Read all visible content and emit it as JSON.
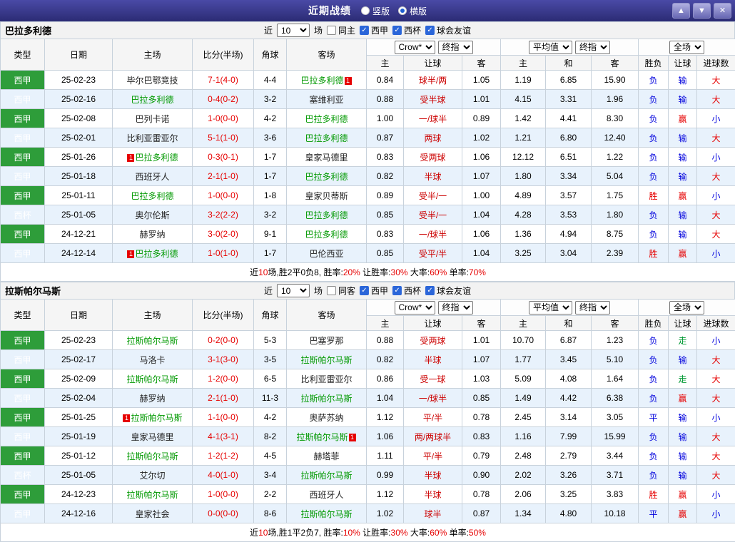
{
  "titlebar": {
    "title": "近期战绩",
    "radios": [
      {
        "label": "竖版",
        "selected": false
      },
      {
        "label": "横版",
        "selected": true
      }
    ],
    "buttons": [
      {
        "name": "up",
        "glyph": "▲"
      },
      {
        "name": "down",
        "glyph": "▼"
      },
      {
        "name": "close",
        "glyph": "✕"
      }
    ]
  },
  "icons": {
    "check": "✓",
    "red_card": "1"
  },
  "colors": {
    "titlebar": "#32327e",
    "league_green": "#2e9d3a",
    "cup_teal": "#0b7f6e",
    "focus_team": "#009900",
    "win_red": "#e60000",
    "lose_blue": "#0000dd",
    "push_green": "#009933",
    "zebra_blue": "#e8f2fc"
  },
  "table_header": {
    "main_columns": [
      "类型",
      "日期",
      "主场",
      "比分(半场)",
      "角球",
      "客场"
    ],
    "sub_columns": [
      "主",
      "让球",
      "客",
      "主",
      "和",
      "客",
      "胜负",
      "让球",
      "进球数"
    ]
  },
  "sections": [
    {
      "team": "巴拉多利德",
      "filters": {
        "prefix": "近",
        "games": "10",
        "suffix": "场",
        "checkboxes": [
          {
            "label": "同主",
            "checked": false
          },
          {
            "label": "西甲",
            "checked": true
          },
          {
            "label": "西杯",
            "checked": true
          },
          {
            "label": "球会友谊",
            "checked": true
          }
        ]
      },
      "odds_groups": [
        [
          "Crow*",
          "终指"
        ],
        [
          "平均值",
          "终指"
        ],
        [
          "全场"
        ]
      ],
      "rows": [
        {
          "league": "西甲",
          "cup": false,
          "date": "25-02-23",
          "home": {
            "name": "毕尔巴鄂竞技",
            "focus": false,
            "card": ""
          },
          "score": "7-1(4-0)",
          "corners": "4-4",
          "away": {
            "name": "巴拉多利德",
            "focus": true,
            "card": "after"
          },
          "odds": [
            "0.84",
            "球半/两",
            "1.05"
          ],
          "avg": [
            "1.19",
            "6.85",
            "15.90"
          ],
          "results": [
            [
              "负",
              "b"
            ],
            [
              "输",
              "b"
            ],
            [
              "大",
              "r"
            ]
          ]
        },
        {
          "league": "西甲",
          "cup": false,
          "date": "25-02-16",
          "home": {
            "name": "巴拉多利德",
            "focus": true,
            "card": ""
          },
          "score": "0-4(0-2)",
          "corners": "3-2",
          "away": {
            "name": "塞维利亚",
            "focus": false,
            "card": ""
          },
          "odds": [
            "0.88",
            "受半球",
            "1.01"
          ],
          "avg": [
            "4.15",
            "3.31",
            "1.96"
          ],
          "results": [
            [
              "负",
              "b"
            ],
            [
              "输",
              "b"
            ],
            [
              "大",
              "r"
            ]
          ]
        },
        {
          "league": "西甲",
          "cup": false,
          "date": "25-02-08",
          "home": {
            "name": "巴列卡诺",
            "focus": false,
            "card": ""
          },
          "score": "1-0(0-0)",
          "corners": "4-2",
          "away": {
            "name": "巴拉多利德",
            "focus": true,
            "card": ""
          },
          "odds": [
            "1.00",
            "一/球半",
            "0.89"
          ],
          "avg": [
            "1.42",
            "4.41",
            "8.30"
          ],
          "results": [
            [
              "负",
              "b"
            ],
            [
              "赢",
              "r"
            ],
            [
              "小",
              "b"
            ]
          ]
        },
        {
          "league": "西甲",
          "cup": false,
          "date": "25-02-01",
          "home": {
            "name": "比利亚雷亚尔",
            "focus": false,
            "card": ""
          },
          "score": "5-1(1-0)",
          "corners": "3-6",
          "away": {
            "name": "巴拉多利德",
            "focus": true,
            "card": ""
          },
          "odds": [
            "0.87",
            "两球",
            "1.02"
          ],
          "avg": [
            "1.21",
            "6.80",
            "12.40"
          ],
          "results": [
            [
              "负",
              "b"
            ],
            [
              "输",
              "b"
            ],
            [
              "大",
              "r"
            ]
          ]
        },
        {
          "league": "西甲",
          "cup": false,
          "date": "25-01-26",
          "home": {
            "name": "巴拉多利德",
            "focus": true,
            "card": "before"
          },
          "score": "0-3(0-1)",
          "corners": "1-7",
          "away": {
            "name": "皇家马德里",
            "focus": false,
            "card": ""
          },
          "odds": [
            "0.83",
            "受两球",
            "1.06"
          ],
          "avg": [
            "12.12",
            "6.51",
            "1.22"
          ],
          "results": [
            [
              "负",
              "b"
            ],
            [
              "输",
              "b"
            ],
            [
              "小",
              "b"
            ]
          ]
        },
        {
          "league": "西甲",
          "cup": false,
          "date": "25-01-18",
          "home": {
            "name": "西班牙人",
            "focus": false,
            "card": ""
          },
          "score": "2-1(1-0)",
          "corners": "1-7",
          "away": {
            "name": "巴拉多利德",
            "focus": true,
            "card": ""
          },
          "odds": [
            "0.82",
            "半球",
            "1.07"
          ],
          "avg": [
            "1.80",
            "3.34",
            "5.04"
          ],
          "results": [
            [
              "负",
              "b"
            ],
            [
              "输",
              "b"
            ],
            [
              "大",
              "r"
            ]
          ]
        },
        {
          "league": "西甲",
          "cup": false,
          "date": "25-01-11",
          "home": {
            "name": "巴拉多利德",
            "focus": true,
            "card": ""
          },
          "score": "1-0(0-0)",
          "corners": "1-8",
          "away": {
            "name": "皇家贝蒂斯",
            "focus": false,
            "card": ""
          },
          "odds": [
            "0.89",
            "受半/一",
            "1.00"
          ],
          "avg": [
            "4.89",
            "3.57",
            "1.75"
          ],
          "results": [
            [
              "胜",
              "r"
            ],
            [
              "赢",
              "r"
            ],
            [
              "小",
              "b"
            ]
          ]
        },
        {
          "league": "西杯",
          "cup": true,
          "date": "25-01-05",
          "home": {
            "name": "奥尔伦斯",
            "focus": false,
            "card": ""
          },
          "score": "3-2(2-2)",
          "corners": "3-2",
          "away": {
            "name": "巴拉多利德",
            "focus": true,
            "card": ""
          },
          "odds": [
            "0.85",
            "受半/一",
            "1.04"
          ],
          "avg": [
            "4.28",
            "3.53",
            "1.80"
          ],
          "results": [
            [
              "负",
              "b"
            ],
            [
              "输",
              "b"
            ],
            [
              "大",
              "r"
            ]
          ]
        },
        {
          "league": "西甲",
          "cup": false,
          "date": "24-12-21",
          "home": {
            "name": "赫罗纳",
            "focus": false,
            "card": ""
          },
          "score": "3-0(2-0)",
          "corners": "9-1",
          "away": {
            "name": "巴拉多利德",
            "focus": true,
            "card": ""
          },
          "odds": [
            "0.83",
            "一/球半",
            "1.06"
          ],
          "avg": [
            "1.36",
            "4.94",
            "8.75"
          ],
          "results": [
            [
              "负",
              "b"
            ],
            [
              "输",
              "b"
            ],
            [
              "大",
              "r"
            ]
          ]
        },
        {
          "league": "西甲",
          "cup": false,
          "date": "24-12-14",
          "home": {
            "name": "巴拉多利德",
            "focus": true,
            "card": "before"
          },
          "score": "1-0(1-0)",
          "corners": "1-7",
          "away": {
            "name": "巴伦西亚",
            "focus": false,
            "card": ""
          },
          "odds": [
            "0.85",
            "受平/半",
            "1.04"
          ],
          "avg": [
            "3.25",
            "3.04",
            "2.39"
          ],
          "results": [
            [
              "胜",
              "r"
            ],
            [
              "赢",
              "r"
            ],
            [
              "小",
              "b"
            ]
          ]
        }
      ],
      "summary": [
        [
          "近",
          "k"
        ],
        [
          "10",
          "r"
        ],
        [
          "场,胜2平0负8, 胜率:",
          "k"
        ],
        [
          "20%",
          "r"
        ],
        [
          " 让胜率:",
          "k"
        ],
        [
          "30%",
          "r"
        ],
        [
          " 大率:",
          "k"
        ],
        [
          "60%",
          "r"
        ],
        [
          " 单率:",
          "k"
        ],
        [
          "70%",
          "r"
        ]
      ]
    },
    {
      "team": "拉斯帕尔马斯",
      "filters": {
        "prefix": "近",
        "games": "10",
        "suffix": "场",
        "checkboxes": [
          {
            "label": "同客",
            "checked": false
          },
          {
            "label": "西甲",
            "checked": true
          },
          {
            "label": "西杯",
            "checked": true
          },
          {
            "label": "球会友谊",
            "checked": true
          }
        ]
      },
      "odds_groups": [
        [
          "Crow*",
          "终指"
        ],
        [
          "平均值",
          "终指"
        ],
        [
          "全场"
        ]
      ],
      "rows": [
        {
          "league": "西甲",
          "cup": false,
          "date": "25-02-23",
          "home": {
            "name": "拉斯帕尔马斯",
            "focus": true,
            "card": ""
          },
          "score": "0-2(0-0)",
          "corners": "5-3",
          "away": {
            "name": "巴塞罗那",
            "focus": false,
            "card": ""
          },
          "odds": [
            "0.88",
            "受两球",
            "1.01"
          ],
          "avg": [
            "10.70",
            "6.87",
            "1.23"
          ],
          "results": [
            [
              "负",
              "b"
            ],
            [
              "走",
              "g"
            ],
            [
              "小",
              "b"
            ]
          ]
        },
        {
          "league": "西甲",
          "cup": false,
          "date": "25-02-17",
          "home": {
            "name": "马洛卡",
            "focus": false,
            "card": ""
          },
          "score": "3-1(3-0)",
          "corners": "3-5",
          "away": {
            "name": "拉斯帕尔马斯",
            "focus": true,
            "card": ""
          },
          "odds": [
            "0.82",
            "半球",
            "1.07"
          ],
          "avg": [
            "1.77",
            "3.45",
            "5.10"
          ],
          "results": [
            [
              "负",
              "b"
            ],
            [
              "输",
              "b"
            ],
            [
              "大",
              "r"
            ]
          ]
        },
        {
          "league": "西甲",
          "cup": false,
          "date": "25-02-09",
          "home": {
            "name": "拉斯帕尔马斯",
            "focus": true,
            "card": ""
          },
          "score": "1-2(0-0)",
          "corners": "6-5",
          "away": {
            "name": "比利亚雷亚尔",
            "focus": false,
            "card": ""
          },
          "odds": [
            "0.86",
            "受一球",
            "1.03"
          ],
          "avg": [
            "5.09",
            "4.08",
            "1.64"
          ],
          "results": [
            [
              "负",
              "b"
            ],
            [
              "走",
              "g"
            ],
            [
              "大",
              "r"
            ]
          ]
        },
        {
          "league": "西甲",
          "cup": false,
          "date": "25-02-04",
          "home": {
            "name": "赫罗纳",
            "focus": false,
            "card": ""
          },
          "score": "2-1(1-0)",
          "corners": "11-3",
          "away": {
            "name": "拉斯帕尔马斯",
            "focus": true,
            "card": ""
          },
          "odds": [
            "1.04",
            "一/球半",
            "0.85"
          ],
          "avg": [
            "1.49",
            "4.42",
            "6.38"
          ],
          "results": [
            [
              "负",
              "b"
            ],
            [
              "赢",
              "r"
            ],
            [
              "大",
              "r"
            ]
          ]
        },
        {
          "league": "西甲",
          "cup": false,
          "date": "25-01-25",
          "home": {
            "name": "拉斯帕尔马斯",
            "focus": true,
            "card": "before"
          },
          "score": "1-1(0-0)",
          "corners": "4-2",
          "away": {
            "name": "奥萨苏纳",
            "focus": false,
            "card": ""
          },
          "odds": [
            "1.12",
            "平/半",
            "0.78"
          ],
          "avg": [
            "2.45",
            "3.14",
            "3.05"
          ],
          "results": [
            [
              "平",
              "b"
            ],
            [
              "输",
              "b"
            ],
            [
              "小",
              "b"
            ]
          ]
        },
        {
          "league": "西甲",
          "cup": false,
          "date": "25-01-19",
          "home": {
            "name": "皇家马德里",
            "focus": false,
            "card": ""
          },
          "score": "4-1(3-1)",
          "corners": "8-2",
          "away": {
            "name": "拉斯帕尔马斯",
            "focus": true,
            "card": "after"
          },
          "odds": [
            "1.06",
            "两/两球半",
            "0.83"
          ],
          "avg": [
            "1.16",
            "7.99",
            "15.99"
          ],
          "results": [
            [
              "负",
              "b"
            ],
            [
              "输",
              "b"
            ],
            [
              "大",
              "r"
            ]
          ]
        },
        {
          "league": "西甲",
          "cup": false,
          "date": "25-01-12",
          "home": {
            "name": "拉斯帕尔马斯",
            "focus": true,
            "card": ""
          },
          "score": "1-2(1-2)",
          "corners": "4-5",
          "away": {
            "name": "赫塔菲",
            "focus": false,
            "card": ""
          },
          "odds": [
            "1.11",
            "平/半",
            "0.79"
          ],
          "avg": [
            "2.48",
            "2.79",
            "3.44"
          ],
          "results": [
            [
              "负",
              "b"
            ],
            [
              "输",
              "b"
            ],
            [
              "大",
              "r"
            ]
          ]
        },
        {
          "league": "西杯",
          "cup": true,
          "date": "25-01-05",
          "home": {
            "name": "艾尔切",
            "focus": false,
            "card": ""
          },
          "score": "4-0(1-0)",
          "corners": "3-4",
          "away": {
            "name": "拉斯帕尔马斯",
            "focus": true,
            "card": ""
          },
          "odds": [
            "0.99",
            "半球",
            "0.90"
          ],
          "avg": [
            "2.02",
            "3.26",
            "3.71"
          ],
          "results": [
            [
              "负",
              "b"
            ],
            [
              "输",
              "b"
            ],
            [
              "大",
              "r"
            ]
          ]
        },
        {
          "league": "西甲",
          "cup": false,
          "date": "24-12-23",
          "home": {
            "name": "拉斯帕尔马斯",
            "focus": true,
            "card": ""
          },
          "score": "1-0(0-0)",
          "corners": "2-2",
          "away": {
            "name": "西班牙人",
            "focus": false,
            "card": ""
          },
          "odds": [
            "1.12",
            "半球",
            "0.78"
          ],
          "avg": [
            "2.06",
            "3.25",
            "3.83"
          ],
          "results": [
            [
              "胜",
              "r"
            ],
            [
              "赢",
              "r"
            ],
            [
              "小",
              "b"
            ]
          ]
        },
        {
          "league": "西甲",
          "cup": false,
          "date": "24-12-16",
          "home": {
            "name": "皇家社会",
            "focus": false,
            "card": ""
          },
          "score": "0-0(0-0)",
          "corners": "8-6",
          "away": {
            "name": "拉斯帕尔马斯",
            "focus": true,
            "card": ""
          },
          "odds": [
            "1.02",
            "球半",
            "0.87"
          ],
          "avg": [
            "1.34",
            "4.80",
            "10.18"
          ],
          "results": [
            [
              "平",
              "b"
            ],
            [
              "赢",
              "r"
            ],
            [
              "小",
              "b"
            ]
          ]
        }
      ],
      "summary": [
        [
          "近",
          "k"
        ],
        [
          "10",
          "r"
        ],
        [
          "场,胜1平2负7, 胜率:",
          "k"
        ],
        [
          "10%",
          "r"
        ],
        [
          " 让胜率:",
          "k"
        ],
        [
          "30%",
          "r"
        ],
        [
          " 大率:",
          "k"
        ],
        [
          "60%",
          "r"
        ],
        [
          " 单率:",
          "k"
        ],
        [
          "50%",
          "r"
        ]
      ]
    }
  ]
}
